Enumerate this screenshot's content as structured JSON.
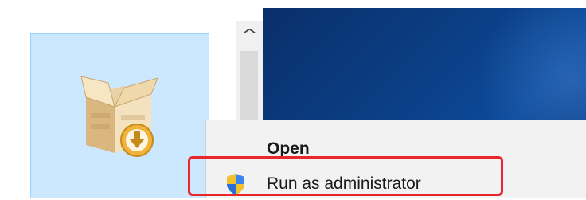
{
  "context_menu": {
    "items": [
      {
        "label": "Open",
        "icon": "none",
        "default": true
      },
      {
        "label": "Run as administrator",
        "icon": "uac-shield-icon"
      }
    ]
  },
  "scrollbar": {
    "up_arrow": "^"
  },
  "file_item": {
    "icon": "installer-package-icon"
  },
  "colors": {
    "selection_fill": "#cce8ff",
    "selection_border": "#99d1ff",
    "menu_background": "#f2f2f2",
    "desktop_background": "#0b3f86",
    "highlight_box": "#e8262b"
  }
}
